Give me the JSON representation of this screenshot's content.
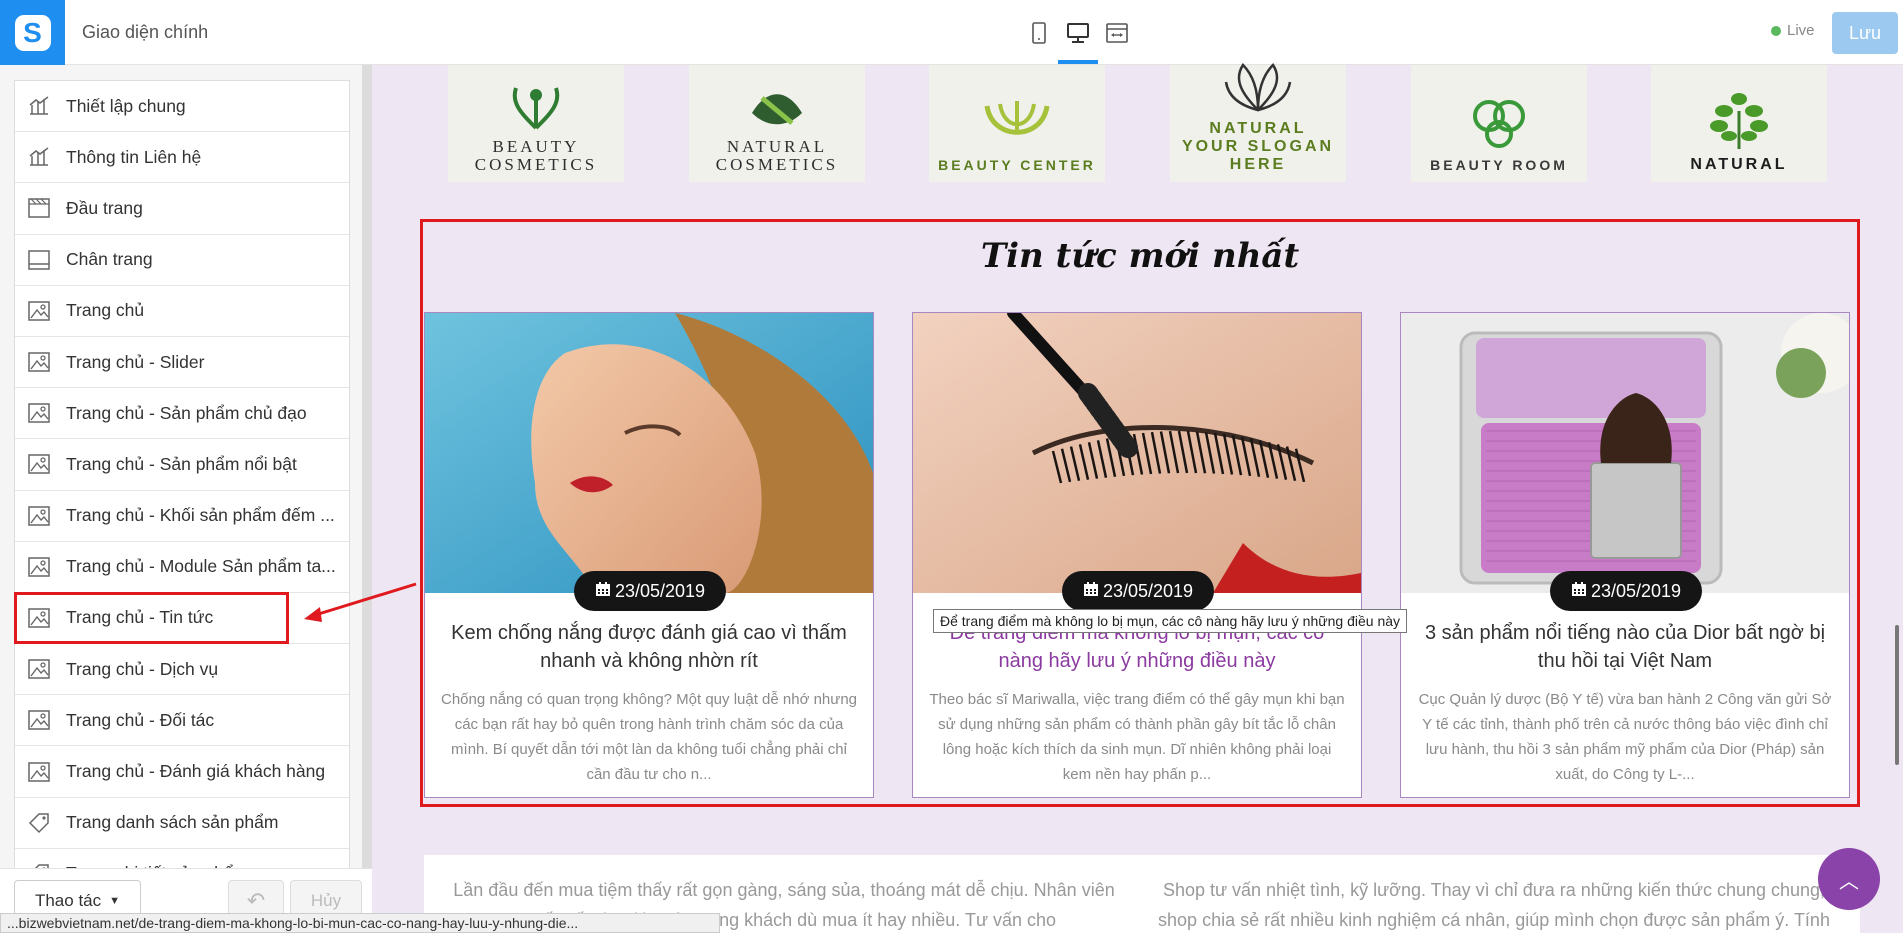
{
  "app": {
    "title": "Giao diện chính",
    "logo_letter": "S"
  },
  "toolbar": {
    "devices": [
      {
        "name": "mobile-view-icon"
      },
      {
        "name": "desktop-view-icon",
        "active": true
      },
      {
        "name": "fullwidth-view-icon"
      }
    ],
    "live_label": "Live",
    "save_label": "Lưu"
  },
  "sidebar": {
    "items": [
      {
        "label": "Thiết lập chung",
        "icon": "settings-icon"
      },
      {
        "label": "Thông tin Liên hệ",
        "icon": "settings-icon"
      },
      {
        "label": "Đầu trang",
        "icon": "header-icon"
      },
      {
        "label": "Chân trang",
        "icon": "footer-icon"
      },
      {
        "label": "Trang chủ",
        "icon": "image-icon"
      },
      {
        "label": "Trang chủ - Slider",
        "icon": "image-icon"
      },
      {
        "label": "Trang chủ - Sản phẩm chủ đạo",
        "icon": "image-icon"
      },
      {
        "label": "Trang chủ - Sản phẩm nổi bật",
        "icon": "image-icon"
      },
      {
        "label": "Trang chủ - Khối sản phẩm đếm ...",
        "icon": "image-icon"
      },
      {
        "label": "Trang chủ - Module Sản phẩm ta...",
        "icon": "image-icon"
      },
      {
        "label": "Trang chủ - Tin tức",
        "icon": "image-icon",
        "highlighted": true
      },
      {
        "label": "Trang chủ - Dịch vụ",
        "icon": "image-icon"
      },
      {
        "label": "Trang chủ - Đối tác",
        "icon": "image-icon"
      },
      {
        "label": "Trang chủ - Đánh giá khách hàng",
        "icon": "image-icon"
      },
      {
        "label": "Trang danh sách sản phẩm",
        "icon": "tag-icon"
      },
      {
        "label": "Trang chi tiết sản phẩm",
        "icon": "tag-icon"
      }
    ],
    "actions_label": "Thao tác",
    "cancel_label": "Hủy"
  },
  "status_url": "...bizwebvietnam.net/de-trang-diem-ma-khong-lo-bi-mun-cac-co-nang-hay-luu-y-nhung-die...",
  "brands": [
    {
      "text": "BEAUTY\nCOSMETICS"
    },
    {
      "text": "NATURAL\nCOSMETICS"
    },
    {
      "text": "BEAUTY CENTER"
    },
    {
      "text": "NATURAL\nYOUR SLOGAN HERE"
    },
    {
      "text": "BEAUTY ROOM"
    },
    {
      "text": "NATURAL"
    }
  ],
  "news": {
    "title": "Tin tức mới nhất",
    "cards": [
      {
        "date": "23/05/2019",
        "title": "Kem chống nắng được đánh giá cao vì thấm nhanh và không nhờn rít",
        "excerpt": "Chống nắng có quan trọng không? Một quy luật dễ nhớ nhưng các bạn rất hay bỏ quên trong hành trình chăm sóc da của mình. Bí quyết dẫn tới một làn da không tuổi chẳng phải chỉ cần đầu tư cho n..."
      },
      {
        "date": "23/05/2019",
        "title": "Để trang điểm mà không lo bị mụn, các cô nàng hãy lưu ý những điều này",
        "excerpt": "Theo bác sĩ Mariwalla, việc trang điểm có thể gây mụn khi bạn sử dụng những sản phẩm có thành phần gây bít tắc lỗ chân lông hoặc kích thích da sinh mụn. Dĩ nhiên không phải loại kem nền hay phấn p..."
      },
      {
        "date": "23/05/2019",
        "title": "3 sản phẩm nổi tiếng nào của Dior bất ngờ bị thu hồi tại Việt Nam",
        "excerpt": "Cục Quản lý dược (Bộ Y tế) vừa ban hành 2 Công văn gửi Sở Y tế các tỉnh, thành phố trên cả nước thông báo việc đình chỉ lưu hành, thu hồi 3 sản phẩm mỹ phẩm của Dior (Pháp) sản xuất, do Công ty L-..."
      }
    ],
    "tooltip": "Để trang điểm mà không lo bị mụn, các cô nàng hãy lưu ý những điều này"
  },
  "reviews": [
    "Lần đầu đến mua tiệm thấy rất gọn gàng, sáng sủa, thoáng mát dễ chịu. Nhân viên tư vấn rất chu đáo, tôn trọng khách dù mua ít hay nhiều. Tư vấn cho",
    "Shop tư vấn nhiệt tình, kỹ lưỡng. Thay vì chỉ đưa ra những kiến thức chung chung, shop chia sẻ rất nhiều kinh nghiệm cá nhân, giúp mình chọn được sản phẩm ý. Tính"
  ],
  "colors": {
    "accent": "#1e8ff0",
    "highlight": "#e0191e",
    "purple": "#8a43a8"
  }
}
